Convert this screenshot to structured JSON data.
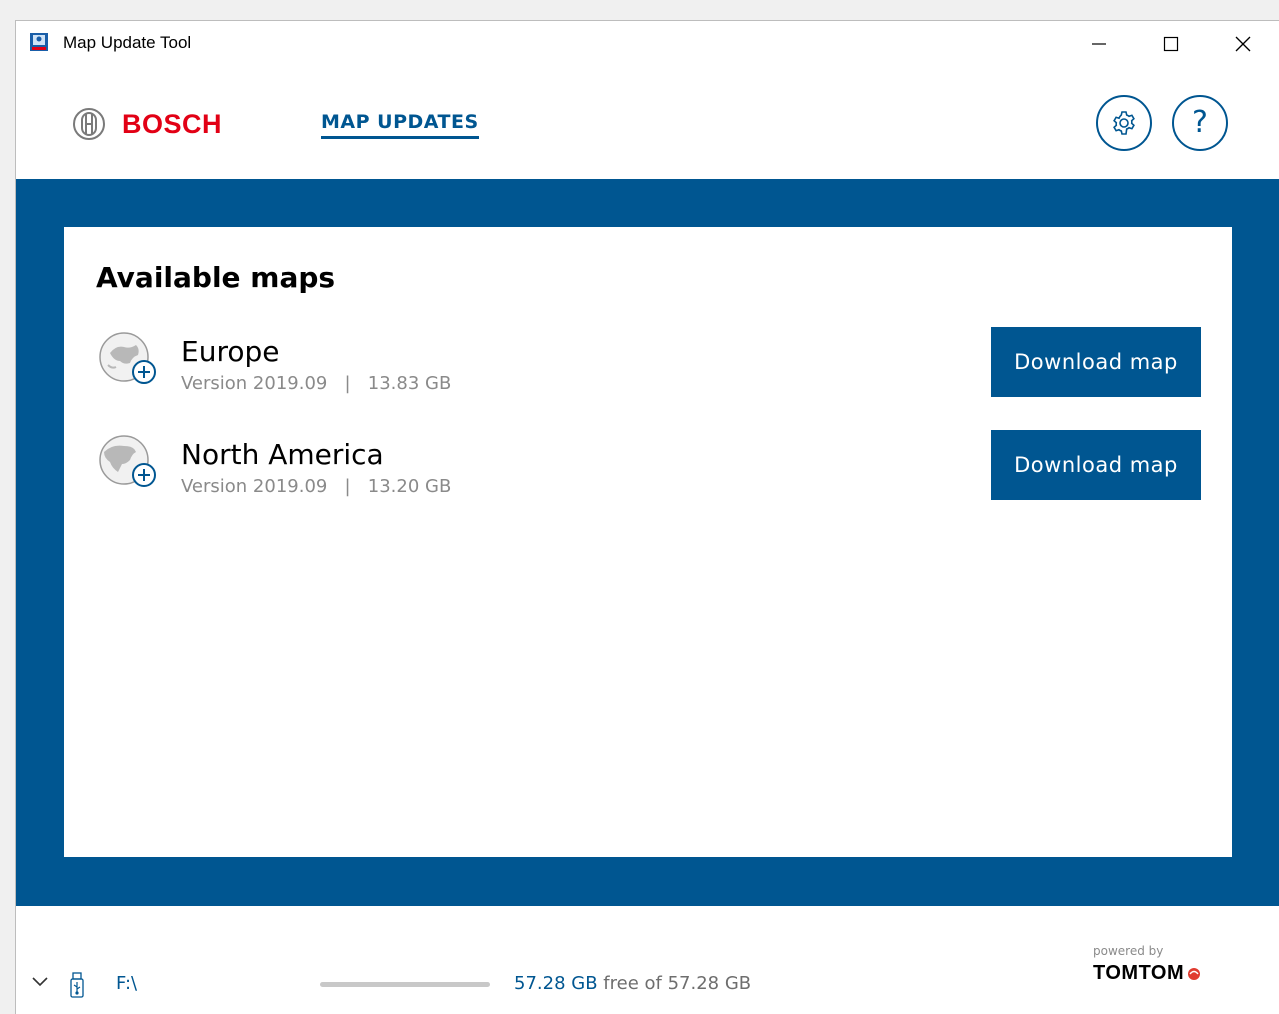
{
  "window": {
    "title": "Map Update Tool"
  },
  "header": {
    "brand": "BOSCH",
    "nav_tab": "MAP UPDATES",
    "help_glyph": "?"
  },
  "main": {
    "section_title": "Available maps",
    "maps": [
      {
        "name": "Europe",
        "version": "Version 2019.09",
        "separator": "|",
        "size": "13.83 GB",
        "button_label": "Download map"
      },
      {
        "name": "North America",
        "version": "Version 2019.09",
        "separator": "|",
        "size": "13.20 GB",
        "button_label": "Download map"
      }
    ]
  },
  "footer": {
    "drive": "F:\\",
    "storage_free": "57.28 GB",
    "storage_suffix": " free of 57.28 GB",
    "powered_by": "powered by",
    "partner": "TOMTOM"
  },
  "colors": {
    "accent": "#005691",
    "brand_red": "#e20015",
    "muted_text": "#8a8a8a",
    "tomtom_red": "#e03b2f"
  },
  "icons": {
    "app": "app-icon",
    "minimize": "minimize-icon",
    "maximize": "maximize-icon",
    "close": "close-icon",
    "brand": "bosch-armature-icon",
    "settings": "gear-icon",
    "help": "help-icon",
    "map_add": "globe-add-icon",
    "expand": "chevron-down-icon",
    "usb": "usb-drive-icon"
  }
}
